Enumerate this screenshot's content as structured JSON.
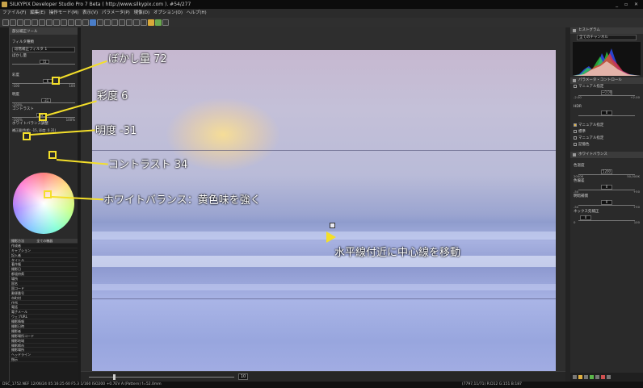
{
  "titlebar": {
    "title": "SILKYPIX Developer Studio Pro 7 Beta ( http://www.silkypix.com ).  #54/277",
    "controls": "_ ▫ ✕"
  },
  "menubar": {
    "items": [
      "ファイル(F)",
      "編集(E)",
      "操作モード(M)",
      "表示(V)",
      "パラメータ(P)",
      "現像(D)",
      "オプション(O)",
      "ヘルプ(H)"
    ]
  },
  "left_panel": {
    "header": "部分補正ツール",
    "filter_type_label": "フィルタ種類",
    "filter_type_value": "段階補正フィルタ 1",
    "blur_label": "ぼかし量",
    "blur_value": "72",
    "saturation_label": "彩度",
    "saturation_value": "6",
    "saturation_min": "-100",
    "saturation_max": "100",
    "lightness_label": "明度",
    "lightness_value": "-31",
    "lightness_min": "-100%",
    "contrast_label": "コントラスト",
    "contrast_value": "34",
    "contrast_min": "-100%",
    "contrast_max": "100%",
    "wb_label": "ホワイトバランス調整",
    "wb_value": "補正量(色相: -15, 彩度: 0.31)",
    "list_header_left": "撮影方法",
    "list_header_right": "全ての機器",
    "list_rows": [
      "作成者",
      "キャプション",
      "記入者",
      "タイトル",
      "著作権",
      "撮影日",
      "都道府県",
      "場所",
      "国名",
      "国コード",
      "郵便番号",
      "市町村",
      "住所",
      "電話",
      "電子メール",
      "ウェブURL",
      "撮影情報",
      "撮影日時",
      "撮影者",
      "撮影場所コード",
      "撮影地域",
      "撮影都市",
      "撮影場所",
      "ヘッドライン",
      "指示"
    ]
  },
  "annotations": {
    "blur": "ぼかし量 72",
    "saturation": "彩度 6",
    "lightness": "明度 -31",
    "contrast": "コントラスト 34",
    "whitebalance": "ホワイトバランス：黄色味を強く",
    "horizon": "水平線付近に中心線を移動"
  },
  "canvas": {
    "zoom_value": "10"
  },
  "statusbar": {
    "left": "DSC_1752.NEF 12/06/24 05:16:25 60 F5.3 1/160 ISO200 +0.7EV A:(Pattern) f=52.0mm",
    "right": "(7797,11/71) R:D12 G:151 B:187"
  },
  "right_panel": {
    "histogram_header": "ヒストグラム",
    "histogram_channel": "全てのチャンネル",
    "param_header": "パラメータ・コントロール",
    "exposure_label": "マニュアル指定",
    "exposure_value": "+0.00",
    "exposure_min": "-2.00",
    "exposure_max": "+2.00",
    "hdr_label": "HDR",
    "hdr_value": "0",
    "wb_mode": "マニュアル指定",
    "tone_mode": "標準",
    "color_mode": "マニュアル指定",
    "sharp_mode": "記憶色",
    "wb_header": "ホワイトバランス",
    "temp_label": "色温度",
    "temp_value": "5200",
    "temp_min": "2000K",
    "temp_max": "50,000K",
    "tint_label": "色偏差",
    "tint_value": "0",
    "tint_min": "-50",
    "tint_max": "+50",
    "skin_label": "明暗補償",
    "skin_value": "0",
    "skin_min": "-50",
    "skin_max": "+50",
    "hl_label": "ネックス先補正",
    "hl_value": "0",
    "hl_min": "0",
    "hl_max": "100"
  }
}
